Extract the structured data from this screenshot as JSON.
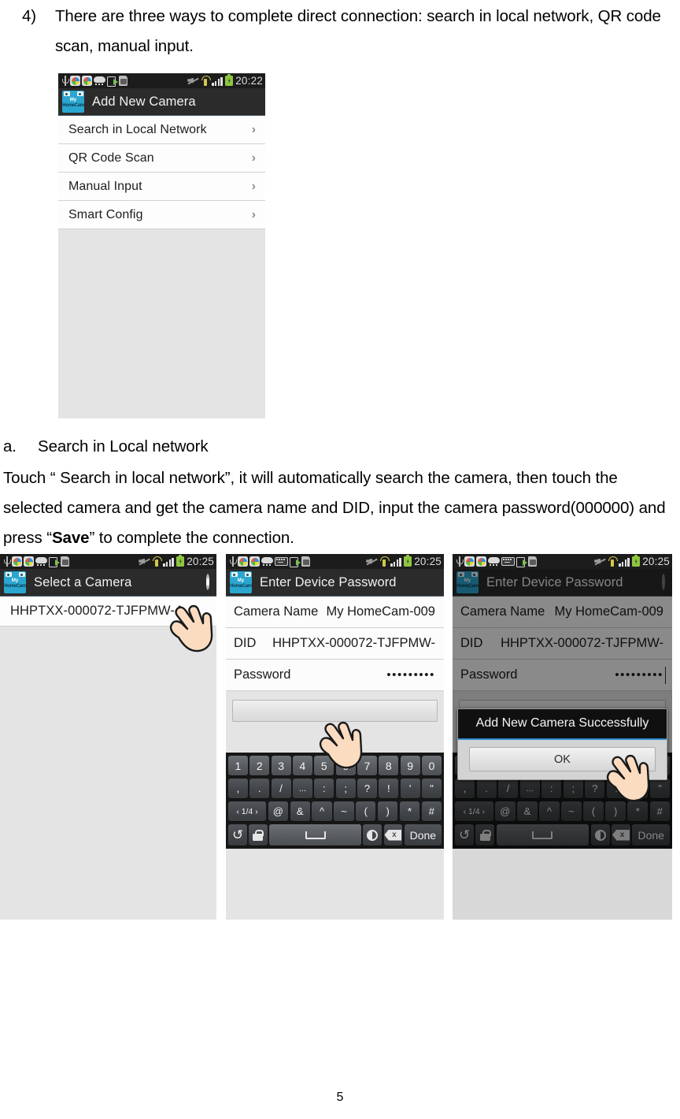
{
  "document": {
    "item_number": "4)",
    "item_text": "There are three ways to complete direct connection: search in local network, QR code scan, manual input.",
    "section_marker": "a.",
    "section_title": "Search in Local network",
    "body_before_bold": "Touch “ Search in local network”, it will automatically search the camera, then touch the selected camera and get the camera name and DID, input the camera password(000000) and press “",
    "body_bold": "Save",
    "body_after_bold": "” to complete the connection.",
    "page_number": "5"
  },
  "status_bar": {
    "time_2022": "20:22",
    "time_2025": "20:25",
    "icons_left": [
      "usb-icon",
      "browser-icon",
      "browser-icon",
      "cloud-icon",
      "export-icon",
      "sd-card-icon"
    ],
    "icons_left_with_keyboard": [
      "usb-icon",
      "browser-icon",
      "browser-icon",
      "cloud-icon",
      "keyboard-icon",
      "export-icon",
      "sd-card-icon"
    ],
    "icons_right": [
      "mute-icon",
      "vibrate-icon",
      "signal-icon",
      "battery-charging-icon"
    ]
  },
  "screen1": {
    "app_title": "Add New Camera",
    "app_logo_line1": "My",
    "app_logo_line2": "HomeCam",
    "chevron": "›",
    "rows": [
      {
        "label": "Search in Local Network"
      },
      {
        "label": "QR Code Scan"
      },
      {
        "label": "Manual Input"
      },
      {
        "label": "Smart Config"
      }
    ]
  },
  "screen2": {
    "app_title": "Select a Camera",
    "app_logo_line1": "My",
    "app_logo_line2": "HomeCam",
    "refresh_icon": "refresh-icon",
    "camera_item": "HHPTXX-000072-TJFPMW-4"
  },
  "screen3": {
    "app_title": "Enter Device Password",
    "app_logo_line1": "My",
    "app_logo_line2": "HomeCam",
    "fields": [
      {
        "key": "Camera Name",
        "value": "My HomeCam-009"
      },
      {
        "key": "DID",
        "value": "HHPTXX-000072-TJFPMW-"
      },
      {
        "key": "Password",
        "value": "•••••••••"
      }
    ],
    "save_button_label": ""
  },
  "screen4": {
    "app_title": "Enter Device Password",
    "app_logo_line1": "My",
    "app_logo_line2": "HomeCam",
    "action_icon": "circle-icon",
    "fields": [
      {
        "key": "Camera Name",
        "value": "My HomeCam-009"
      },
      {
        "key": "DID",
        "value": "HHPTXX-000072-TJFPMW-"
      },
      {
        "key": "Password",
        "value": "•••••••••"
      }
    ],
    "dialog": {
      "title": "Add New Camera Successfully",
      "ok_label": "OK"
    }
  },
  "keyboard": {
    "row1": [
      "1",
      "2",
      "3",
      "4",
      "5",
      "6",
      "7",
      "8",
      "9",
      "0"
    ],
    "row2": [
      ",",
      ".",
      "/",
      "...",
      ":",
      ";",
      "?",
      "!",
      "'",
      "\""
    ],
    "row3": [
      "‹ 1/4 ›",
      "@",
      "&",
      "^",
      "~",
      "(",
      ")",
      "*",
      "#"
    ],
    "row4": [
      "undo-icon",
      "lock-icon",
      "space-key",
      "contrast-icon",
      "backspace-icon",
      "Done"
    ],
    "done_label": "Done"
  }
}
